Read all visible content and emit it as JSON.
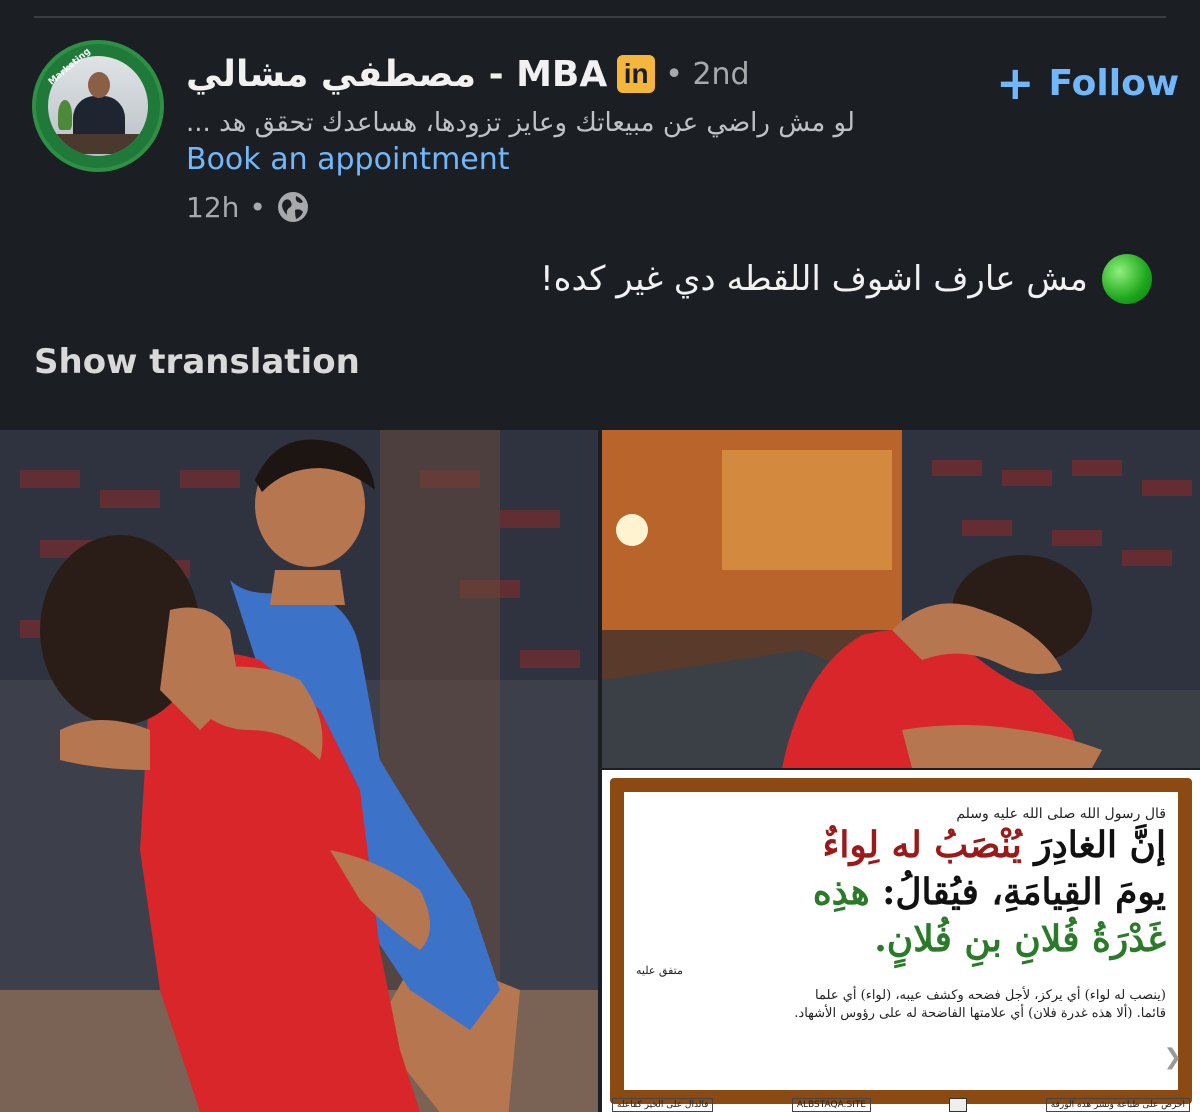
{
  "post": {
    "author": {
      "name": "مصطفي مشالي - MBA",
      "linkedin_badge": "in",
      "degree": "• 2nd",
      "avatar_label": "Marketing",
      "headline": "... لو مش راضي عن مبيعاتك وعايز تزودها، هساعدك تحقق هد",
      "cta_link": "Book an appointment"
    },
    "meta": {
      "time": "12h",
      "separator": "•",
      "visibility_icon": "globe-icon"
    },
    "follow": {
      "label": "Follow",
      "icon": "plus-icon"
    },
    "text": "مش عارف اشوف اللقطه دي غير كده!",
    "text_icon": "green-circle-emoji",
    "show_translation": "Show translation",
    "quote_card": {
      "intro": "قال رسول الله صلى الله عليه وسلم",
      "line1_a": "إنَّ الغادِرَ",
      "line1_b": "يُنْصَبُ له لِواءٌ",
      "line2_a": "يومَ القِيامَةِ، فيُقالُ:",
      "line2_b": "هذِه",
      "line3": "غَدْرَةُ فُلانِ بنِ فُلانٍ.",
      "source": "متفق عليه",
      "note_line1": "(ينصب له لواء) أي يركز، لأجل فضحه وكشف عيبه، (لواء) أي علما",
      "note_line2": "قائما. (ألا هذه غدرة فلان) أي علامتها الفاضحة له على رؤوس الأشهاد.",
      "footer_left": "احرص على طباعة ونشر هذه الورقة",
      "footer_site": "ALBSTAQA.SITE",
      "footer_right": "فالدال على الخير كفاعله"
    },
    "colors": {
      "link": "#71b7fb",
      "background": "#1b1f23",
      "badge": "#f5b73b"
    }
  }
}
